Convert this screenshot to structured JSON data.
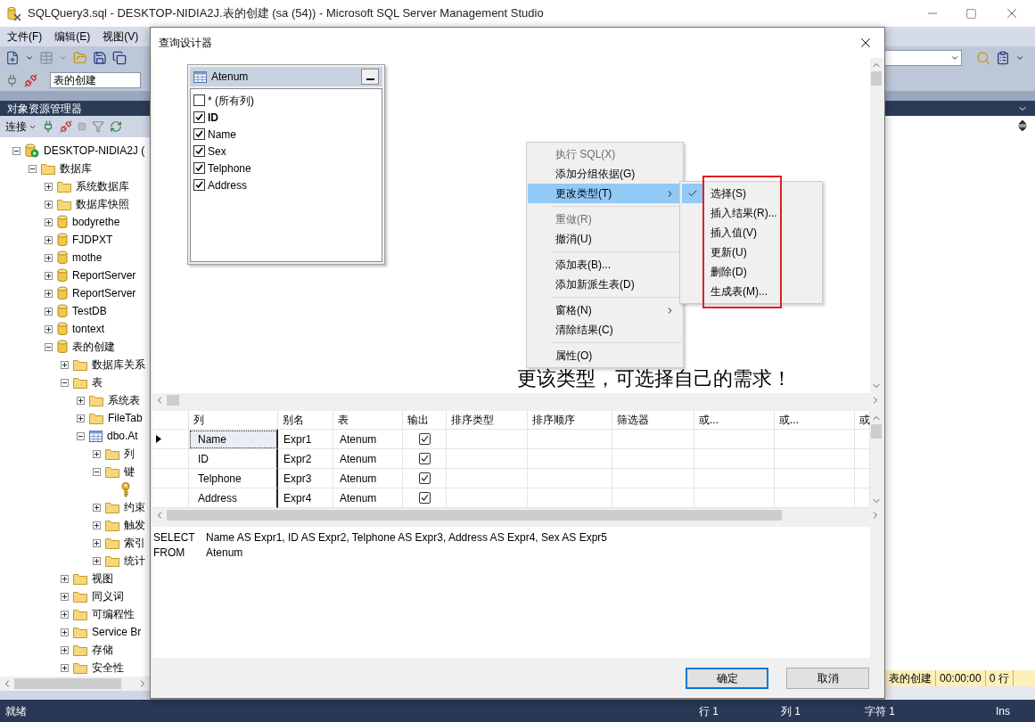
{
  "window": {
    "title": "SQLQuery3.sql - DESKTOP-NIDIA2J.表的创建 (sa (54)) - Microsoft SQL Server Management Studio"
  },
  "menu_bar": [
    {
      "label": "文件(F)"
    },
    {
      "label": "编辑(E)"
    },
    {
      "label": "视图(V)"
    }
  ],
  "toolbar": {
    "database": "表的创建"
  },
  "object_explorer": {
    "title": "对象资源管理器",
    "connect": "连接",
    "tree": [
      {
        "label": "DESKTOP-NIDIA2J (",
        "kind": "server",
        "expanded": true,
        "children": [
          {
            "label": "数据库",
            "kind": "folder",
            "expanded": true,
            "children": [
              {
                "label": "系统数据库",
                "kind": "folder",
                "expanded": false
              },
              {
                "label": "数据库快照",
                "kind": "folder",
                "expanded": false
              },
              {
                "label": "bodyrethe",
                "kind": "database",
                "expanded": false
              },
              {
                "label": "FJDPXT",
                "kind": "database",
                "expanded": false
              },
              {
                "label": "mothe",
                "kind": "database",
                "expanded": false
              },
              {
                "label": "ReportServer",
                "kind": "database",
                "expanded": false
              },
              {
                "label": "ReportServer",
                "kind": "database",
                "expanded": false
              },
              {
                "label": "TestDB",
                "kind": "database",
                "expanded": false
              },
              {
                "label": "tontext",
                "kind": "database",
                "expanded": false
              },
              {
                "label": "表的创建",
                "kind": "database",
                "expanded": true,
                "children": [
                  {
                    "label": "数据库关系",
                    "kind": "folder",
                    "expanded": false
                  },
                  {
                    "label": "表",
                    "kind": "folder",
                    "expanded": true,
                    "children": [
                      {
                        "label": "系统表",
                        "kind": "folder",
                        "expanded": false
                      },
                      {
                        "label": "FileTab",
                        "kind": "folder",
                        "expanded": false
                      },
                      {
                        "label": "dbo.At",
                        "kind": "table",
                        "expanded": true,
                        "children": [
                          {
                            "label": "列",
                            "kind": "folder",
                            "expanded": false
                          },
                          {
                            "label": "键",
                            "kind": "folder",
                            "expanded": true,
                            "children": [
                              {
                                "kind": "key"
                              }
                            ]
                          },
                          {
                            "label": "约束",
                            "kind": "folder",
                            "expanded": false
                          },
                          {
                            "label": "触发",
                            "kind": "folder",
                            "expanded": false
                          },
                          {
                            "label": "索引",
                            "kind": "folder",
                            "expanded": false
                          },
                          {
                            "label": "统计",
                            "kind": "folder",
                            "expanded": false
                          }
                        ]
                      }
                    ]
                  },
                  {
                    "label": "视图",
                    "kind": "folder",
                    "expanded": false
                  },
                  {
                    "label": "同义词",
                    "kind": "folder",
                    "expanded": false
                  },
                  {
                    "label": "可编程性",
                    "kind": "folder",
                    "expanded": false
                  },
                  {
                    "label": "Service Br",
                    "kind": "folder",
                    "expanded": false
                  },
                  {
                    "label": "存储",
                    "kind": "folder",
                    "expanded": false
                  },
                  {
                    "label": "安全性",
                    "kind": "folder",
                    "expanded": false
                  }
                ]
              }
            ]
          }
        ]
      }
    ]
  },
  "query_results_status": [
    "表的创建",
    "00:00:00",
    "0 行"
  ],
  "status_bar": {
    "state": "就绪",
    "line": "行 1",
    "column": "列 1",
    "char": "字符 1",
    "mode": "Ins"
  },
  "dialog": {
    "title": "查询设计器",
    "table_box": {
      "name": "Atenum",
      "columns": [
        {
          "label": "* (所有列)",
          "checked": false,
          "key": false
        },
        {
          "label": "ID",
          "checked": true,
          "key": true
        },
        {
          "label": "Name",
          "checked": true,
          "key": false
        },
        {
          "label": "Sex",
          "checked": true,
          "key": false
        },
        {
          "label": "Telphone",
          "checked": true,
          "key": false
        },
        {
          "label": "Address",
          "checked": true,
          "key": false
        }
      ]
    },
    "context_menu": [
      {
        "kind": "item",
        "label": "执行 SQL(X)",
        "disabled": true,
        "selected": false,
        "submenu": false
      },
      {
        "kind": "item",
        "label": "添加分组依据(G)",
        "disabled": false,
        "selected": false,
        "submenu": false
      },
      {
        "kind": "item",
        "label": "更改类型(T)",
        "disabled": false,
        "selected": true,
        "submenu": true
      },
      {
        "kind": "separator"
      },
      {
        "kind": "item",
        "label": "重做(R)",
        "disabled": true,
        "selected": false,
        "submenu": false
      },
      {
        "kind": "item",
        "label": "撤消(U)",
        "disabled": false,
        "selected": false,
        "submenu": false
      },
      {
        "kind": "separator"
      },
      {
        "kind": "item",
        "label": "添加表(B)...",
        "disabled": false,
        "selected": false,
        "submenu": false
      },
      {
        "kind": "item",
        "label": "添加新派生表(D)",
        "disabled": false,
        "selected": false,
        "submenu": false
      },
      {
        "kind": "separator"
      },
      {
        "kind": "item",
        "label": "窗格(N)",
        "disabled": false,
        "selected": false,
        "submenu": true
      },
      {
        "kind": "item",
        "label": "清除结果(C)",
        "disabled": false,
        "selected": false,
        "submenu": false
      },
      {
        "kind": "separator"
      },
      {
        "kind": "item",
        "label": "属性(O)",
        "disabled": false,
        "selected": false,
        "submenu": false
      }
    ],
    "submenu": [
      {
        "label": "选择(S)",
        "checked": true
      },
      {
        "label": "插入结果(R)...",
        "checked": false
      },
      {
        "label": "插入值(V)",
        "checked": false
      },
      {
        "label": "更新(U)",
        "checked": false
      },
      {
        "label": "删除(D)",
        "checked": false
      },
      {
        "label": "生成表(M)...",
        "checked": false
      }
    ],
    "annotation": "更该类型，可选择自己的需求！",
    "grid": {
      "columns": [
        "列",
        "别名",
        "表",
        "输出",
        "排序类型",
        "排序顺序",
        "筛选器",
        "或...",
        "或...",
        "或"
      ],
      "rows": [
        {
          "column": "Name",
          "alias": "Expr1",
          "table": "Atenum",
          "output": true,
          "current": true
        },
        {
          "column": "ID",
          "alias": "Expr2",
          "table": "Atenum",
          "output": true,
          "current": false
        },
        {
          "column": "Telphone",
          "alias": "Expr3",
          "table": "Atenum",
          "output": true,
          "current": false
        },
        {
          "column": "Address",
          "alias": "Expr4",
          "table": "Atenum",
          "output": true,
          "current": false
        }
      ]
    },
    "sql": [
      {
        "keyword": "SELECT",
        "text": "Name AS Expr1, ID AS Expr2, Telphone AS Expr3, Address AS Expr4, Sex AS Expr5"
      },
      {
        "keyword": "FROM",
        "text": "Atenum"
      }
    ],
    "buttons": [
      {
        "label": "确定",
        "default": true
      },
      {
        "label": "取消",
        "default": false
      }
    ]
  }
}
